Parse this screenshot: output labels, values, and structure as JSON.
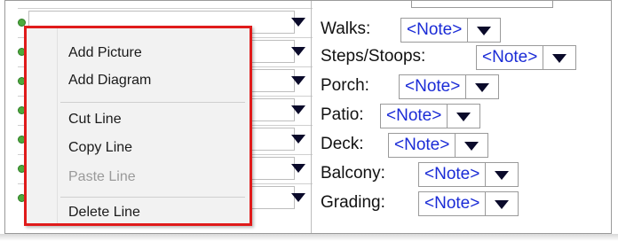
{
  "context_menu": {
    "items": [
      {
        "label": "Add Picture",
        "enabled": true
      },
      {
        "label": "Add Diagram",
        "enabled": true
      },
      {
        "label": "Cut Line",
        "enabled": true
      },
      {
        "label": "Copy Line",
        "enabled": true
      },
      {
        "label": "Paste Line",
        "enabled": false
      },
      {
        "label": "Delete Line",
        "enabled": true
      }
    ],
    "highlight_color": "#e01b1b"
  },
  "fields": [
    {
      "label": "Walks:",
      "value": "<Note>"
    },
    {
      "label": "Steps/Stoops:",
      "value": "<Note>"
    },
    {
      "label": "Porch:",
      "value": "<Note>"
    },
    {
      "label": "Patio:",
      "value": "<Note>"
    },
    {
      "label": "Deck:",
      "value": "<Note>"
    },
    {
      "label": "Balcony:",
      "value": "<Note>"
    },
    {
      "label": "Grading:",
      "value": "<Note>"
    }
  ],
  "colors": {
    "note_text": "#1a2bd6",
    "row_dot": "#4caa3c"
  }
}
